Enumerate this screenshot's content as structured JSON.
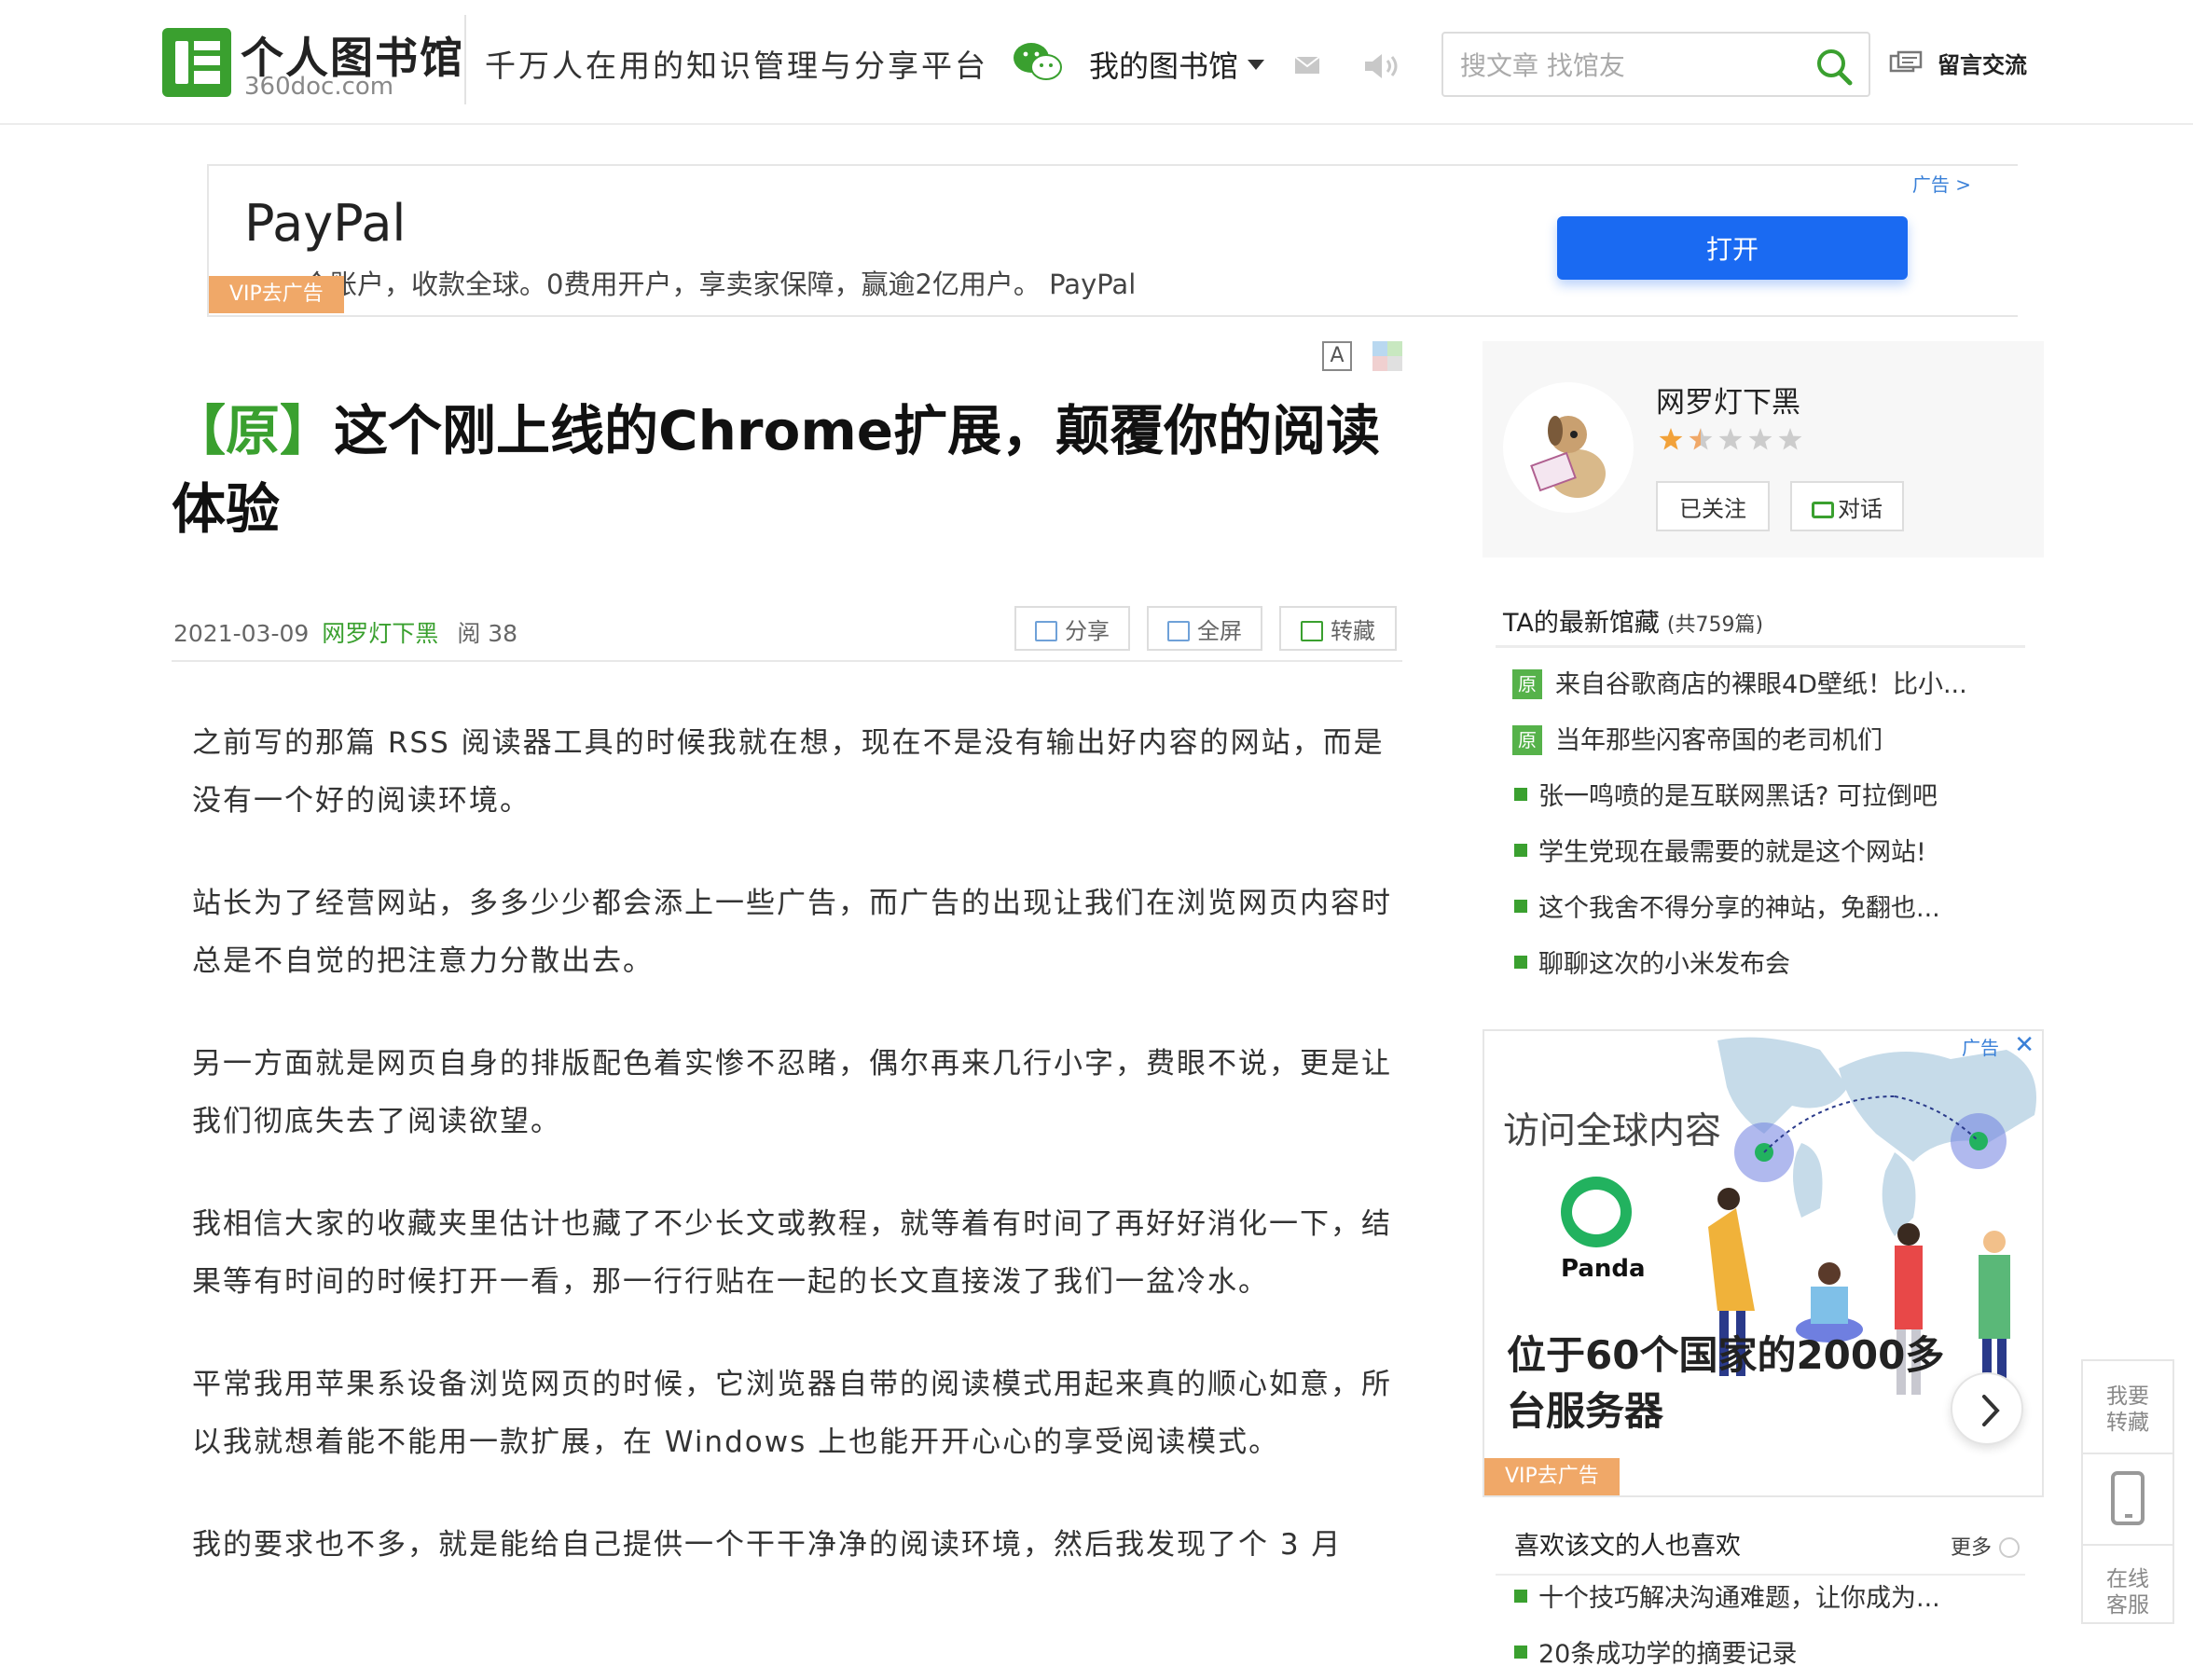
{
  "header": {
    "logo_cn": "个人图书馆",
    "logo_en": "360doc.com",
    "slogan": "千万人在用的知识管理与分享平台",
    "my_library": "我的图书馆",
    "search_placeholder": "搜文章 找馆友",
    "message_label": "留言交流"
  },
  "top_ad": {
    "tag": "广告 >",
    "brand": "PayPal",
    "description": "一个账户，收款全球。0费用开户，享卖家保障，赢逾2亿用户。 PayPal",
    "vip_label": "VIP去广告",
    "open_button": "打开"
  },
  "article": {
    "font_tool": "A",
    "original_tag": "【原】",
    "title": "这个刚上线的Chrome扩展，颠覆你的阅读体验",
    "date": "2021-03-09",
    "author": "网罗灯下黑",
    "reads": "阅 38",
    "actions": {
      "share": "分享",
      "fullscreen": "全屏",
      "collect": "转藏"
    },
    "paragraphs": [
      "之前写的那篇 RSS 阅读器工具的时候我就在想，现在不是没有输出好内容的网站，而是没有一个好的阅读环境。",
      "站长为了经营网站，多多少少都会添上一些广告，而广告的出现让我们在浏览网页内容时总是不自觉的把注意力分散出去。",
      "另一方面就是网页自身的排版配色着实惨不忍睹，偶尔再来几行小字，费眼不说，更是让我们彻底失去了阅读欲望。",
      "我相信大家的收藏夹里估计也藏了不少长文或教程，就等着有时间了再好好消化一下，结果等有时间的时候打开一看，那一行行贴在一起的长文直接泼了我们一盆冷水。",
      "平常我用苹果系设备浏览网页的时候，它浏览器自带的阅读模式用起来真的顺心如意，所以我就想着能不能用一款扩展，在 Windows 上也能开开心心的享受阅读模式。",
      "我的要求也不多，就是能给自己提供一个干干净净的阅读环境，然后我发现了个 3 月"
    ]
  },
  "author_card": {
    "name": "网罗灯下黑",
    "rating": 1.5,
    "rating_max": 5,
    "followed_button": "已关注",
    "chat_button": "对话"
  },
  "latest": {
    "title": "TA的最新馆藏",
    "count": "(共759篇)",
    "items": [
      {
        "orig": "原",
        "text": "来自谷歌商店的裸眼4D壁纸！比小..."
      },
      {
        "orig": "原",
        "text": "当年那些闪客帝国的老司机们"
      },
      {
        "orig": "",
        "text": "张一鸣喷的是互联网黑话? 可拉倒吧"
      },
      {
        "orig": "",
        "text": "学生党现在最需要的就是这个网站!"
      },
      {
        "orig": "",
        "text": "这个我舍不得分享的神站，免翻也..."
      },
      {
        "orig": "",
        "text": "聊聊这次的小米发布会"
      }
    ]
  },
  "side_ad": {
    "tag": "广告",
    "close": "✕",
    "headline": "访问全球内容",
    "brand": "Panda",
    "body": "位于60个国家的2000多台服务器",
    "vip_label": "VIP去广告"
  },
  "likes": {
    "title": "喜欢该文的人也喜欢",
    "more": "更多",
    "items": [
      {
        "text": "十个技巧解决沟通难题，让你成为..."
      },
      {
        "text": "20条成功学的摘要记录"
      }
    ]
  },
  "float_tools": {
    "collect": "我要\n转藏",
    "service": "在线\n客服"
  },
  "colors": {
    "brand_green": "#3aa02f",
    "ad_blue": "#1a6af2",
    "vip_orange": "#f0a868",
    "link_blue": "#3a80d8"
  }
}
